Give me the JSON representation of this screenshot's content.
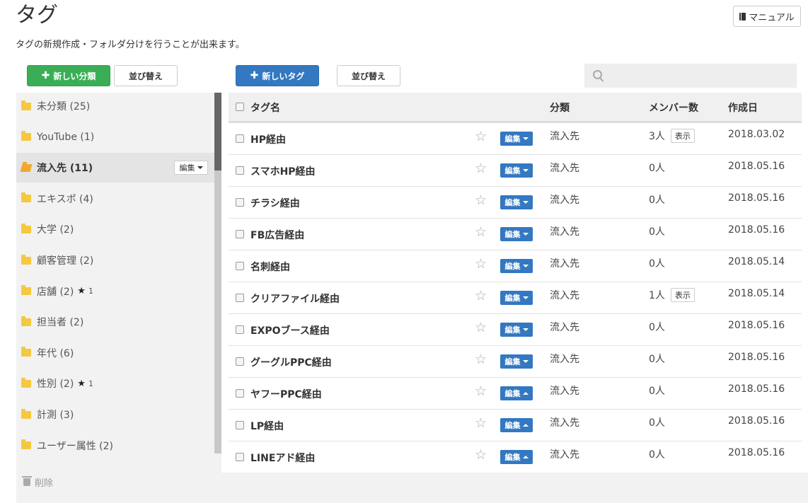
{
  "header": {
    "title": "タグ",
    "subtitle": "タグの新規作成・フォルダ分けを行うことが出来ます。",
    "manual_label": "マニュアル"
  },
  "toolbar": {
    "new_category_label": "新しい分類",
    "sort_left_label": "並び替え",
    "new_tag_label": "新しいタグ",
    "sort_right_label": "並び替え",
    "search_placeholder": ""
  },
  "sidebar": {
    "items": [
      {
        "label": "未分類 (25)",
        "star": ""
      },
      {
        "label": "YouTube (1)",
        "star": ""
      },
      {
        "label": "流入先 (11)",
        "star": "",
        "active": true,
        "edit_label": "編集"
      },
      {
        "label": "エキスポ (4)",
        "star": ""
      },
      {
        "label": "大学 (2)",
        "star": ""
      },
      {
        "label": "顧客管理 (2)",
        "star": ""
      },
      {
        "label": "店舗 (2)",
        "star": "1"
      },
      {
        "label": "担当者 (2)",
        "star": ""
      },
      {
        "label": "年代 (6)",
        "star": ""
      },
      {
        "label": "性別 (2)",
        "star": "1"
      },
      {
        "label": "計測 (3)",
        "star": ""
      },
      {
        "label": "ユーザー属性 (2)",
        "star": ""
      }
    ],
    "delete_label": "削除"
  },
  "table": {
    "headers": {
      "name": "タグ名",
      "category": "分類",
      "members": "メンバー数",
      "created": "作成日"
    },
    "edit_label": "編集",
    "show_label": "表示",
    "rows": [
      {
        "name": "HP経由",
        "category": "流入先",
        "members": "3人",
        "show": true,
        "date": "2018.03.02",
        "caret": "down"
      },
      {
        "name": "スマホHP経由",
        "category": "流入先",
        "members": "0人",
        "show": false,
        "date": "2018.05.16",
        "caret": "down"
      },
      {
        "name": "チラシ経由",
        "category": "流入先",
        "members": "0人",
        "show": false,
        "date": "2018.05.16",
        "caret": "down"
      },
      {
        "name": "FB広告経由",
        "category": "流入先",
        "members": "0人",
        "show": false,
        "date": "2018.05.16",
        "caret": "down"
      },
      {
        "name": "名刺経由",
        "category": "流入先",
        "members": "0人",
        "show": false,
        "date": "2018.05.14",
        "caret": "down"
      },
      {
        "name": "クリアファイル経由",
        "category": "流入先",
        "members": "1人",
        "show": true,
        "date": "2018.05.14",
        "caret": "down"
      },
      {
        "name": "EXPOブース経由",
        "category": "流入先",
        "members": "0人",
        "show": false,
        "date": "2018.05.16",
        "caret": "down"
      },
      {
        "name": "グーグルPPC経由",
        "category": "流入先",
        "members": "0人",
        "show": false,
        "date": "2018.05.16",
        "caret": "down"
      },
      {
        "name": "ヤフーPPC経由",
        "category": "流入先",
        "members": "0人",
        "show": false,
        "date": "2018.05.16",
        "caret": "up"
      },
      {
        "name": "LP経由",
        "category": "流入先",
        "members": "0人",
        "show": false,
        "date": "2018.05.16",
        "caret": "up"
      },
      {
        "name": "LINEアド経由",
        "category": "流入先",
        "members": "0人",
        "show": false,
        "date": "2018.05.16",
        "caret": "up"
      }
    ]
  },
  "colors": {
    "green": "#3aae56",
    "blue": "#3378c1",
    "folder": "#f5c842"
  }
}
